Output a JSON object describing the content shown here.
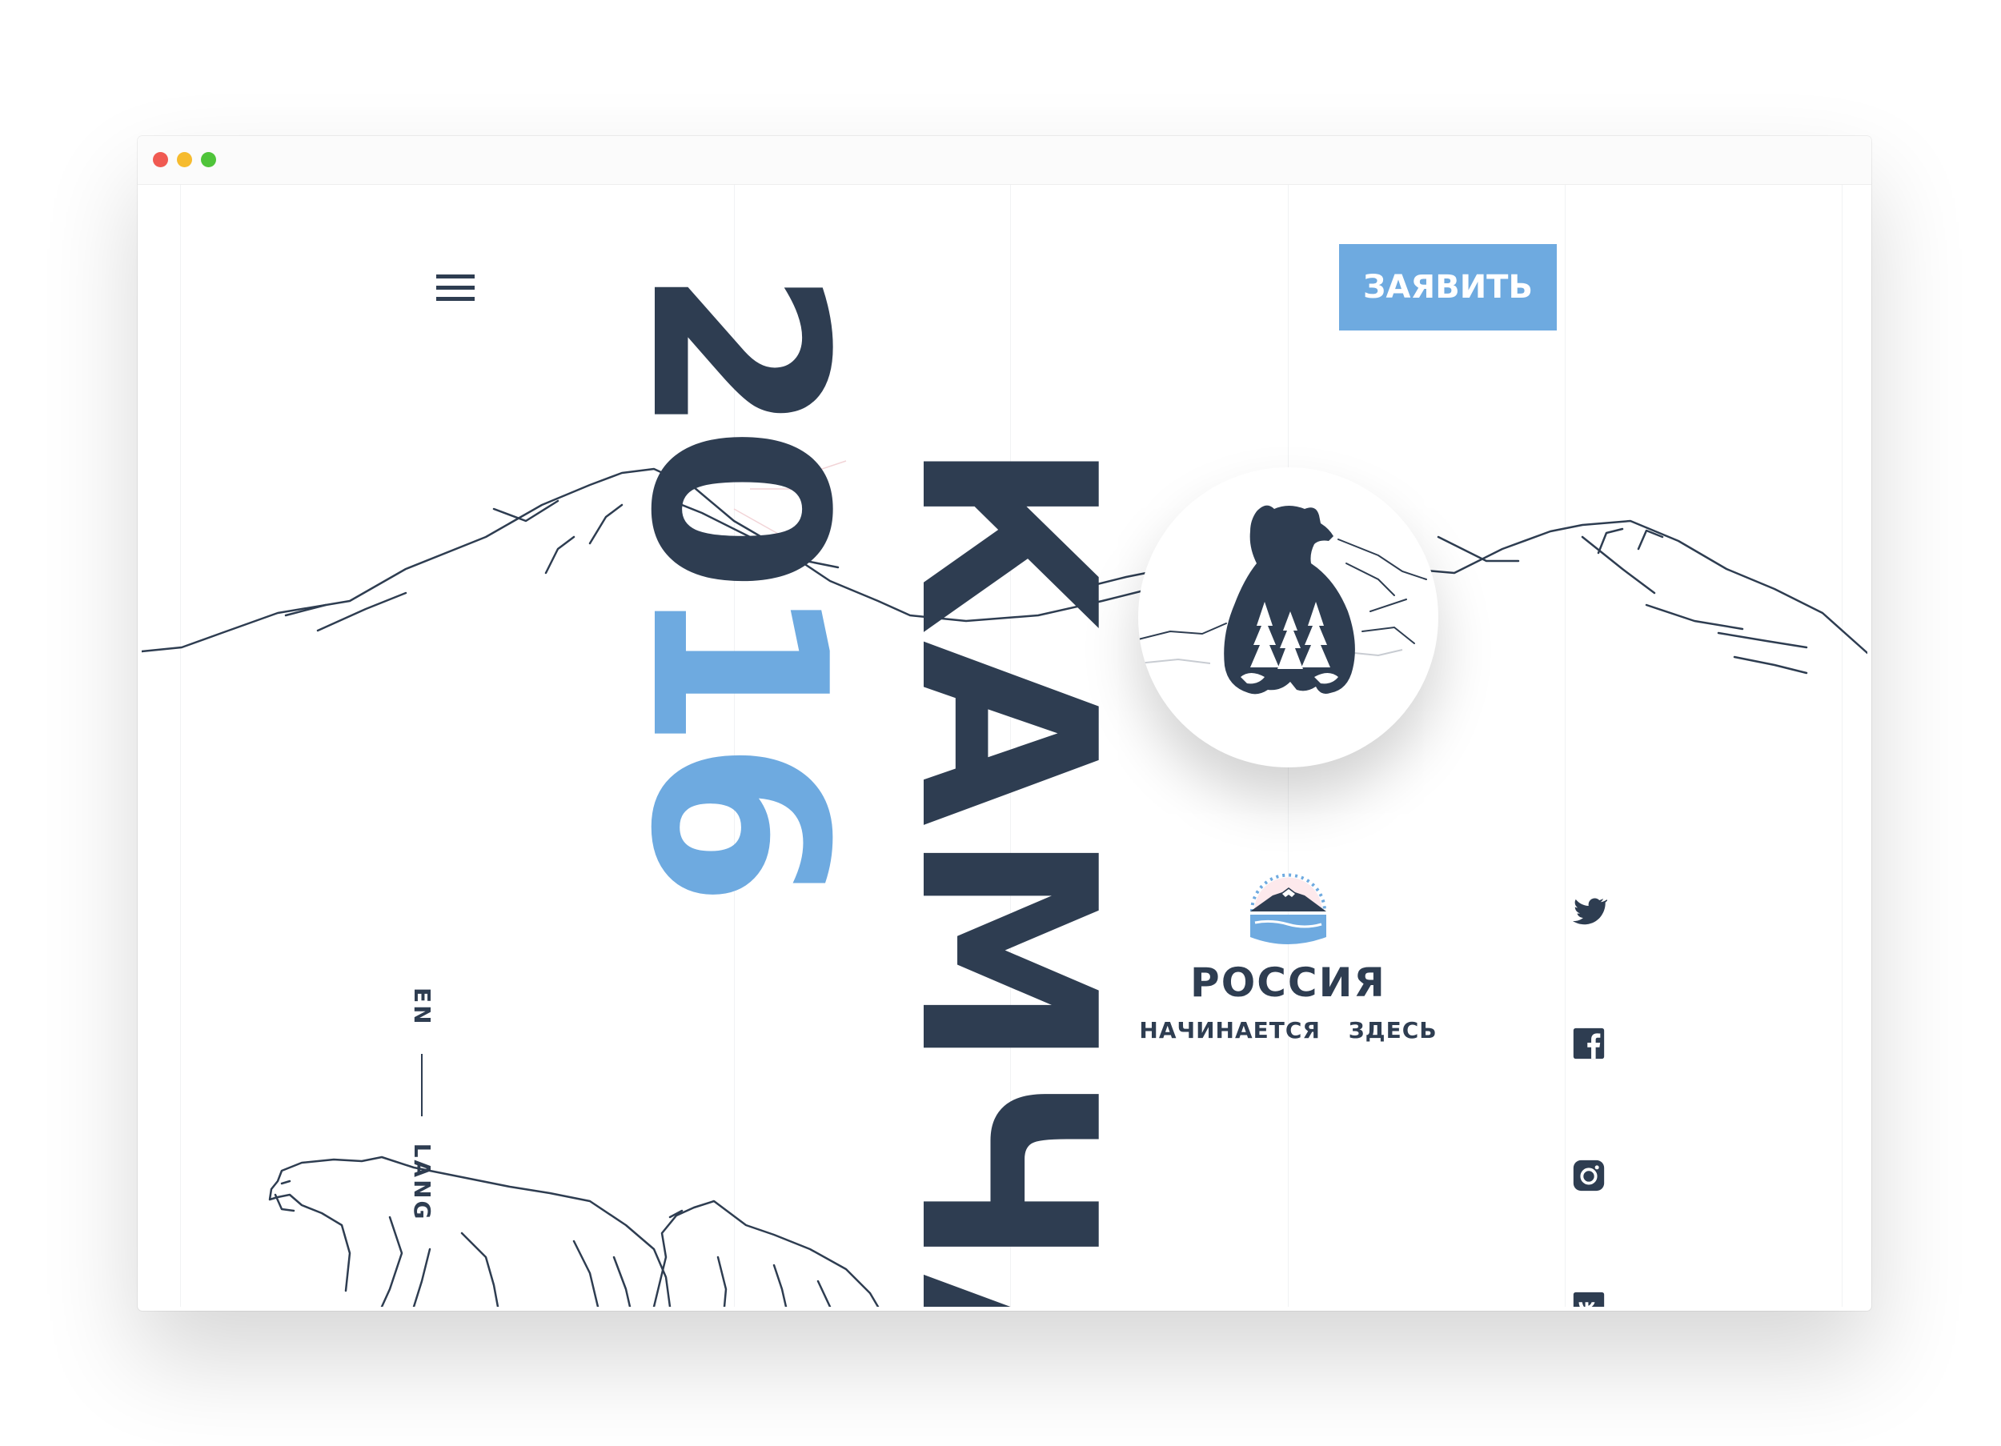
{
  "window": {
    "controls": [
      "close",
      "minimize",
      "maximize"
    ],
    "control_colors": {
      "close": "#f05a52",
      "minimize": "#f6bb2e",
      "maximize": "#4fc43a"
    }
  },
  "header": {
    "menu_icon": "hamburger-menu-icon",
    "apply_button_label": "ЗАЯВИТЬ"
  },
  "hero": {
    "year_prefix": "20",
    "year_suffix": "16",
    "title": "КАМЧА"
  },
  "language": {
    "current": "EN",
    "label": "LANG"
  },
  "badge": {
    "icon": "bear-forest-icon"
  },
  "partner_logo": {
    "icon": "kamchatka-volcano-emblem-icon",
    "name": "РОССИЯ",
    "tagline": "НАЧИНАЕТСЯ ЗДЕСЬ"
  },
  "social_links": [
    {
      "icon": "twitter-icon"
    },
    {
      "icon": "facebook-icon"
    },
    {
      "icon": "instagram-icon"
    },
    {
      "icon": "vk-icon"
    }
  ],
  "illustrations": [
    "mountain-range-line-art",
    "bears-line-art"
  ],
  "colors": {
    "navy": "#2e3d51",
    "accent_blue": "#6eaae0",
    "gridline": "#f1f2f4",
    "window_background": "#ffffff"
  }
}
